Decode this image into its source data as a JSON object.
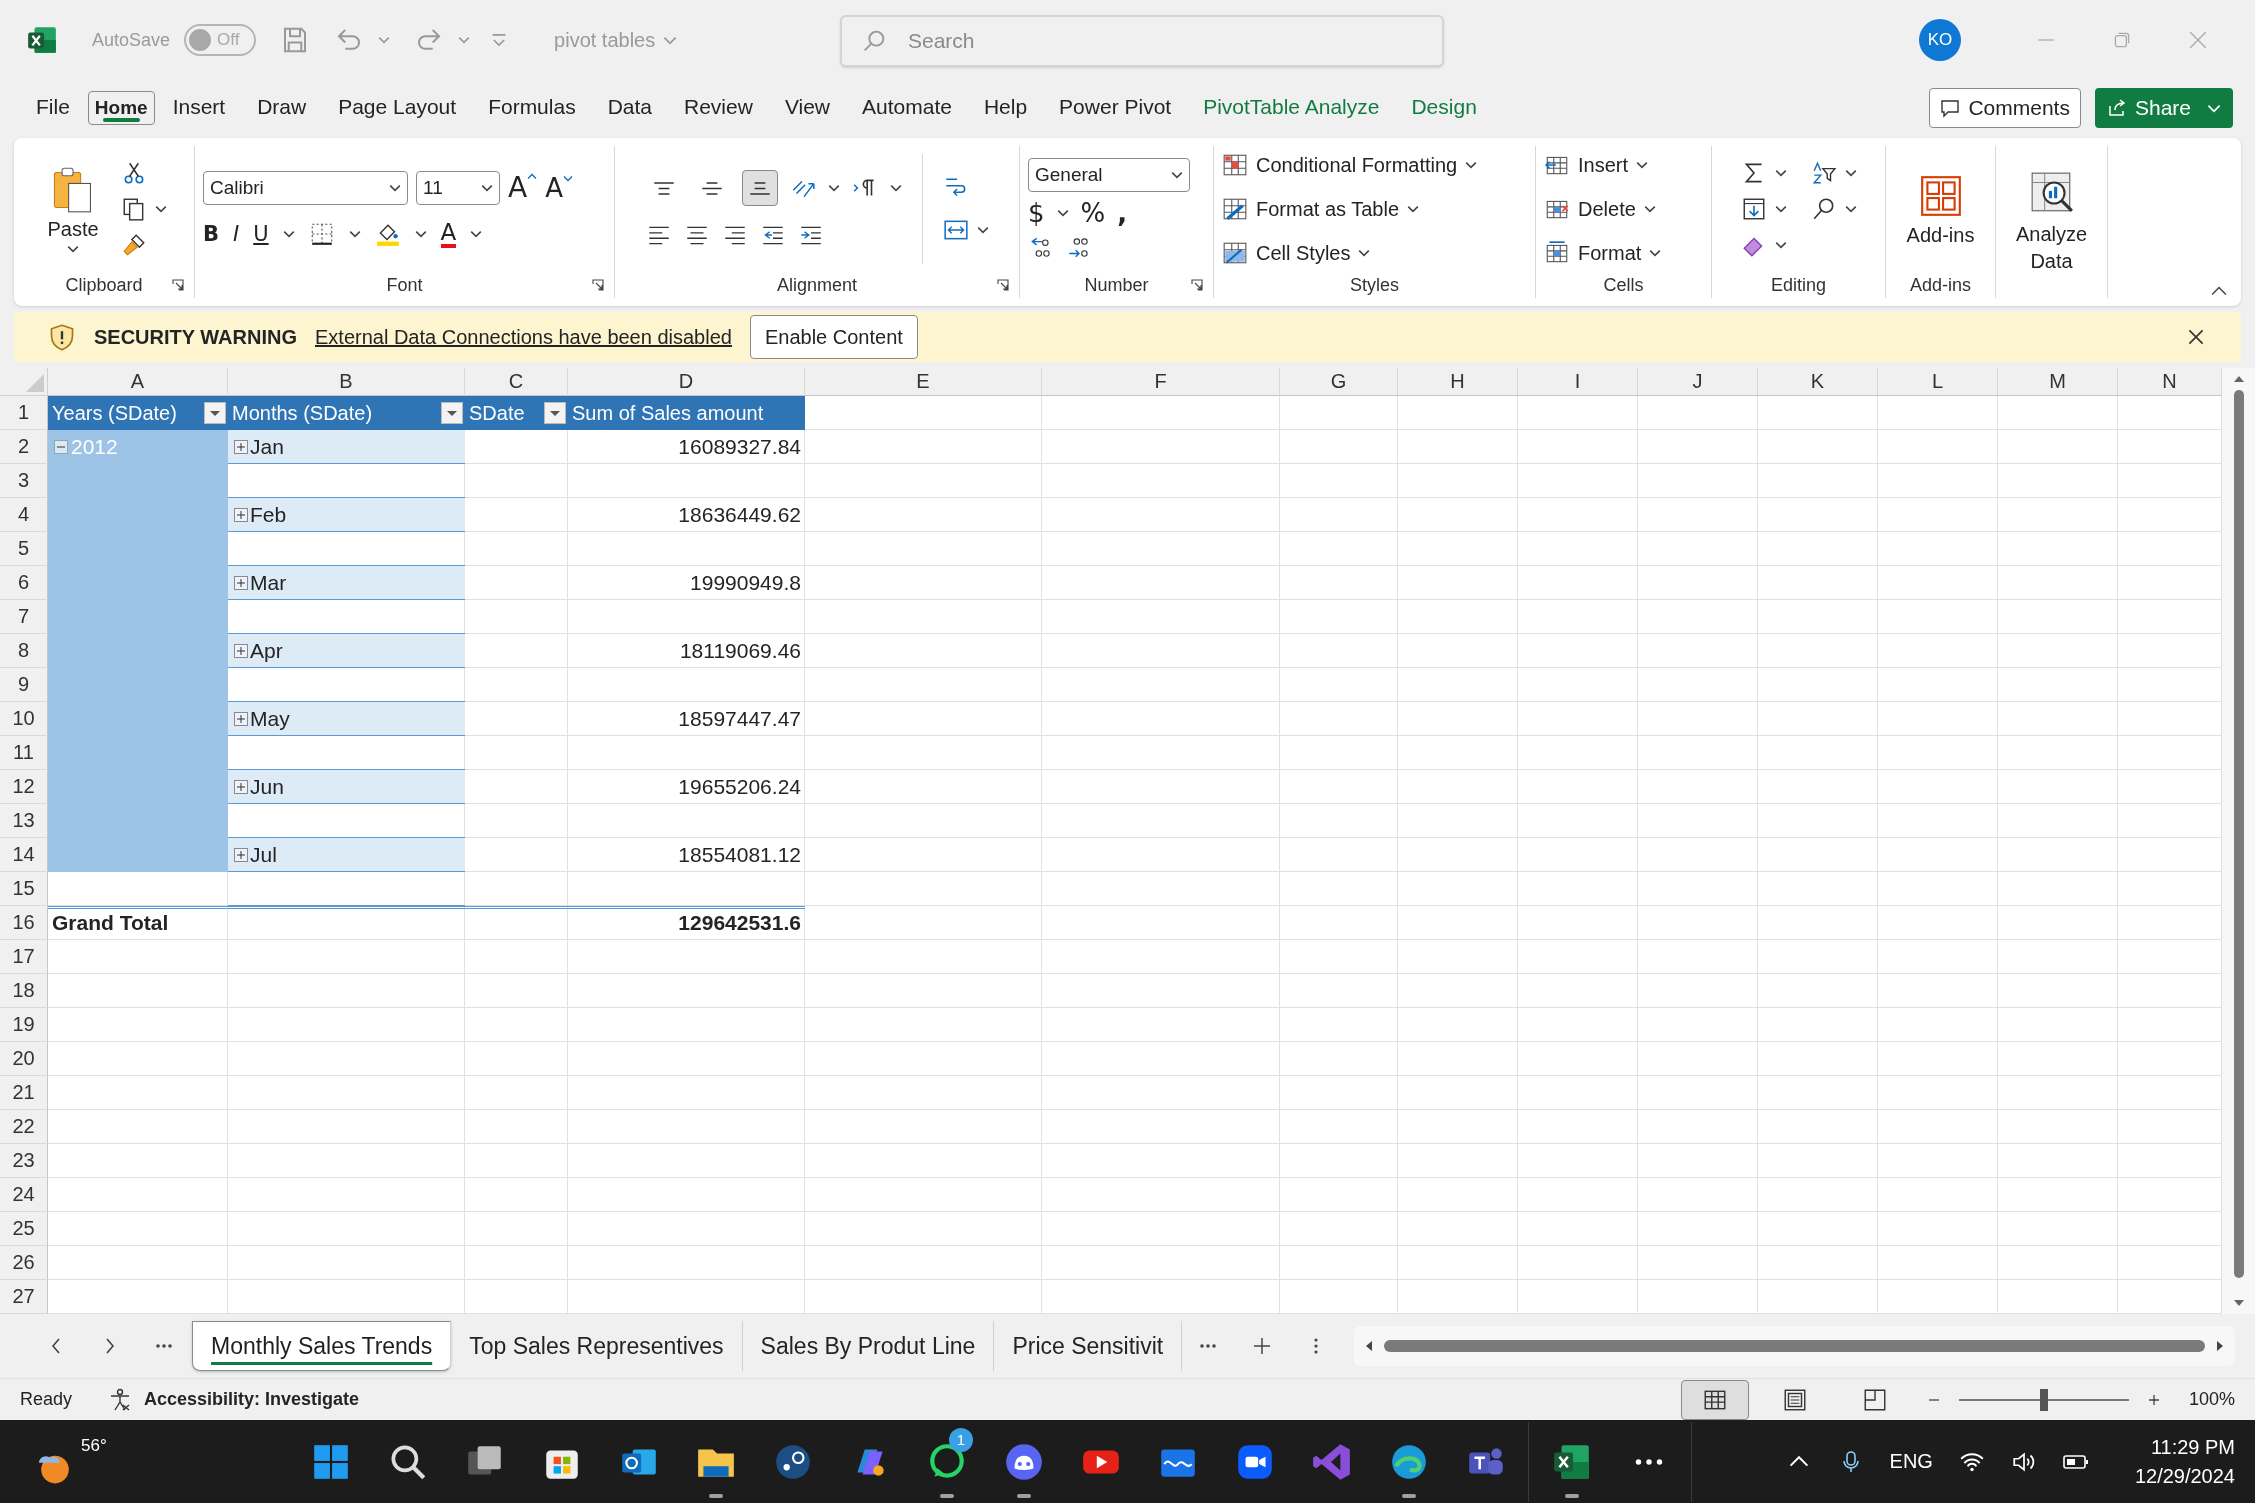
{
  "window": {
    "autosave_label": "AutoSave",
    "autosave": {
      "on": false,
      "label": "Off"
    },
    "title": "pivot tables",
    "search_placeholder": "Search",
    "account_initials": "KO"
  },
  "menu_tabs": [
    {
      "label": "File",
      "kind": "plain",
      "selected": false
    },
    {
      "label": "Home",
      "kind": "plain",
      "selected": true
    },
    {
      "label": "Insert",
      "kind": "plain",
      "selected": false
    },
    {
      "label": "Draw",
      "kind": "plain",
      "selected": false
    },
    {
      "label": "Page Layout",
      "kind": "plain",
      "selected": false
    },
    {
      "label": "Formulas",
      "kind": "plain",
      "selected": false
    },
    {
      "label": "Data",
      "kind": "plain",
      "selected": false
    },
    {
      "label": "Review",
      "kind": "plain",
      "selected": false
    },
    {
      "label": "View",
      "kind": "plain",
      "selected": false
    },
    {
      "label": "Automate",
      "kind": "plain",
      "selected": false
    },
    {
      "label": "Help",
      "kind": "plain",
      "selected": false
    },
    {
      "label": "Power Pivot",
      "kind": "plain",
      "selected": false
    },
    {
      "label": "PivotTable Analyze",
      "kind": "contextual",
      "selected": false
    },
    {
      "label": "Design",
      "kind": "contextual",
      "selected": false
    }
  ],
  "comments_button": "Comments",
  "share_button": "Share",
  "ribbon": {
    "clipboard": {
      "label": "Clipboard",
      "paste": "Paste"
    },
    "font": {
      "label": "Font",
      "name": "Calibri",
      "size": "11",
      "grow": "A",
      "shrink": "A",
      "bold": "B",
      "italic": "I",
      "underline": "U",
      "font_color": "A"
    },
    "alignment": {
      "label": "Alignment",
      "vertical": [
        {
          "kind": "top",
          "selected": false
        },
        {
          "kind": "middle",
          "selected": false
        },
        {
          "kind": "bottom",
          "selected": true
        }
      ]
    },
    "number": {
      "label": "Number",
      "format": "General",
      "currency": "$",
      "percent": "%",
      "comma": ","
    },
    "styles": {
      "label": "Styles",
      "items": [
        {
          "kind": "conditional",
          "label": "Conditional Formatting"
        },
        {
          "kind": "table",
          "label": "Format as Table"
        },
        {
          "kind": "cellstyles",
          "label": "Cell Styles"
        }
      ]
    },
    "cells": {
      "label": "Cells",
      "items": [
        {
          "kind": "insert",
          "label": "Insert"
        },
        {
          "kind": "delete",
          "label": "Delete"
        },
        {
          "kind": "format",
          "label": "Format"
        }
      ]
    },
    "editing": {
      "label": "Editing"
    },
    "addins": {
      "label": "Add-ins",
      "button": "Add-ins"
    },
    "analyze": {
      "button": "Analyze Data"
    }
  },
  "security_bar": {
    "title": "SECURITY WARNING",
    "message": "External Data Connections have been disabled",
    "button": "Enable Content"
  },
  "sheet": {
    "columns": [
      "A",
      "B",
      "C",
      "D",
      "E",
      "F",
      "G",
      "H",
      "I",
      "J",
      "K",
      "L",
      "M",
      "N"
    ],
    "row_numbers": [
      "1",
      "2",
      "3",
      "4",
      "5",
      "6",
      "7",
      "8",
      "9",
      "10",
      "11",
      "12",
      "13",
      "14",
      "15",
      "16",
      "17",
      "18",
      "19",
      "20",
      "21",
      "22",
      "23",
      "24",
      "25",
      "26",
      "27"
    ],
    "pivot": {
      "headers": [
        {
          "label": "Years (SDate)",
          "filter": true
        },
        {
          "label": "Months (SDate)",
          "filter": true
        },
        {
          "label": "SDate",
          "filter": true
        },
        {
          "label": "Sum of Sales amount",
          "filter": false
        }
      ],
      "year": {
        "label": "2012",
        "expanded": true
      },
      "months": [
        {
          "label": "Jan",
          "value": "16089327.84",
          "expanded": false
        },
        {
          "label": "Feb",
          "value": "18636449.62",
          "expanded": false
        },
        {
          "label": "Mar",
          "value": "19990949.8",
          "expanded": false
        },
        {
          "label": "Apr",
          "value": "18119069.46",
          "expanded": false
        },
        {
          "label": "May",
          "value": "18597447.47",
          "expanded": false
        },
        {
          "label": "Jun",
          "value": "19655206.24",
          "expanded": false
        },
        {
          "label": "Jul",
          "value": "18554081.12",
          "expanded": false
        }
      ],
      "grand_total": {
        "label": "Grand Total",
        "value": "129642531.6"
      }
    }
  },
  "sheet_tabs": [
    {
      "label": "Monthly Sales Trends",
      "selected": true
    },
    {
      "label": "Top Sales Representives",
      "selected": false
    },
    {
      "label": "Sales By Produt Line",
      "selected": false
    },
    {
      "label": "Price Sensitivit",
      "selected": false
    }
  ],
  "status_bar": {
    "status": "Ready",
    "accessibility": "Accessibility: Investigate",
    "views": [
      {
        "kind": "normal",
        "selected": true
      },
      {
        "kind": "page_layout",
        "selected": false
      },
      {
        "kind": "page_break",
        "selected": false
      }
    ],
    "zoom": {
      "level": 0.5
    },
    "zoom_label": "100%"
  },
  "taskbar": {
    "weather": "56°",
    "apps": [
      {
        "kind": "start",
        "running": false
      },
      {
        "kind": "search",
        "running": false
      },
      {
        "kind": "taskview",
        "running": false
      },
      {
        "kind": "store",
        "running": false
      },
      {
        "kind": "outlook",
        "running": false
      },
      {
        "kind": "explorer",
        "running": true
      },
      {
        "kind": "steam",
        "running": false
      },
      {
        "kind": "copilot",
        "running": false
      },
      {
        "kind": "whatsapp",
        "running": true,
        "badge": "1"
      },
      {
        "kind": "discord",
        "running": true
      },
      {
        "kind": "youtube",
        "running": false
      },
      {
        "kind": "wave",
        "running": false
      },
      {
        "kind": "zoom",
        "running": false
      },
      {
        "kind": "studio",
        "running": false
      },
      {
        "kind": "edge",
        "running": true
      },
      {
        "kind": "teams",
        "running": false
      }
    ],
    "pinned_excel": {
      "running": true
    },
    "language": "ENG",
    "time": "11:29 PM",
    "date": "12/29/2024"
  }
}
